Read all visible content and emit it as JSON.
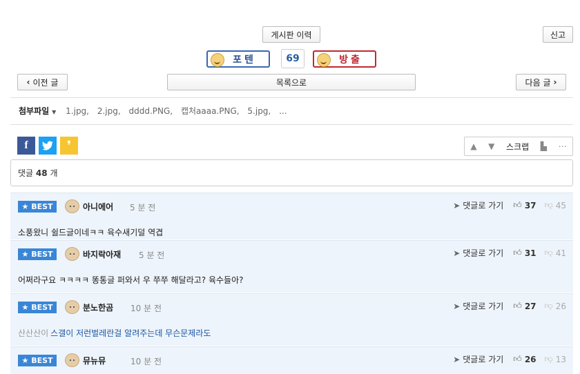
{
  "header": {
    "history_label": "게시판 이력",
    "report_label": "신고",
    "vote_up_label": "포텐",
    "vote_count": "69",
    "vote_down_label": "방출"
  },
  "nav": {
    "prev_label": "이전 글",
    "list_label": "목록으로",
    "next_label": "다음 글"
  },
  "attachments": {
    "label": "첨부파일",
    "files": [
      "1.jpg,",
      "2.jpg,",
      "dddd.PNG,",
      "캡처aaaa.PNG,",
      "5.jpg,",
      "..."
    ]
  },
  "share": {
    "scrap_label": "스크랩"
  },
  "comments_header": {
    "label": "댓글",
    "count": "48",
    "unit": "개"
  },
  "comments": [
    {
      "badge": "BEST",
      "nick": "아니에어",
      "time": "5 분 전",
      "goto": "댓글로 가기",
      "up": "37",
      "down": "45",
      "mention": "",
      "text": "소풍왔니 쉴드글이네ㅋㅋ 육수새기덜 역겹"
    },
    {
      "badge": "BEST",
      "nick": "바지락아재",
      "time": "5 분 전",
      "goto": "댓글로 가기",
      "up": "31",
      "down": "41",
      "mention": "",
      "text": "어쩌라구요 ㅋㅋㅋㅋ 똥통글 퍼와서 우 쭈쭈 해달라고? 육수들아?"
    },
    {
      "badge": "BEST",
      "nick": "분노한곰",
      "time": "10 분 전",
      "goto": "댓글로 가기",
      "up": "27",
      "down": "26",
      "mention": "산산산이",
      "text": "스갤이 저런벌레란걸 알려주는데 무슨문제라도"
    },
    {
      "badge": "BEST",
      "nick": "뮤뉴뮤",
      "time": "10 분 전",
      "goto": "댓글로 가기",
      "up": "26",
      "down": "13",
      "mention": "",
      "text": ""
    }
  ],
  "colors": {
    "vote_up_border": "#3a66b0",
    "vote_down_border": "#c0282f",
    "best_badge": "#3a86d6",
    "comment_bg": "#eef4fb",
    "facebook": "#3b5998",
    "twitter": "#1da1f2",
    "kakao": "#f7c531"
  }
}
